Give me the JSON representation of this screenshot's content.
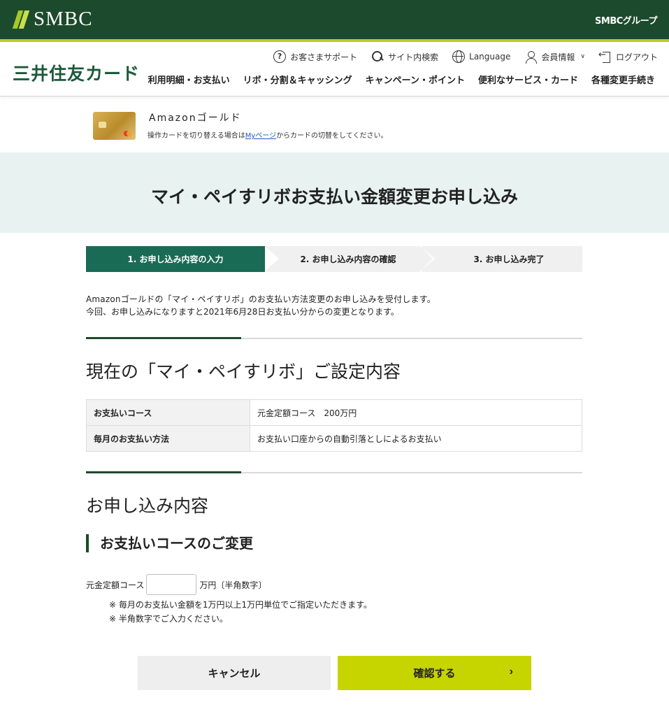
{
  "topbar": {
    "logo_text": "SMBC",
    "group_text": "SMBCグループ"
  },
  "header": {
    "brand": "三井住友カード",
    "util": [
      {
        "label": "お客さまサポート"
      },
      {
        "label": "サイト内検索"
      },
      {
        "label": "Language"
      },
      {
        "label": "会員情報"
      },
      {
        "label": "ログアウト"
      }
    ],
    "gnav": [
      "利用明細・お支払い",
      "リボ・分割＆キャッシング",
      "キャンペーン・ポイント",
      "便利なサービス・カード",
      "各種変更手続き"
    ]
  },
  "card": {
    "name": "Amazonゴールド",
    "note_prefix": "操作カードを切り替える場合は",
    "note_link": "Myページ",
    "note_suffix": "からカードの切替をしてください。"
  },
  "page_title": "マイ・ペイすリボお支払い金額変更お申し込み",
  "steps": [
    {
      "label": "1. お申し込み内容の入力"
    },
    {
      "label": "2. お申し込み内容の確認"
    },
    {
      "label": "3. お申し込み完了"
    }
  ],
  "intro": {
    "line1": "Amazonゴールドの「マイ・ペイすリボ」のお支払い方法変更のお申し込みを受付します。",
    "line2": "今回、お申し込みになりますと2021年6月28日お支払い分からの変更となります。"
  },
  "current": {
    "heading": "現在の「マイ・ペイすリボ」ご設定内容",
    "rows": [
      {
        "label": "お支払いコース",
        "value": "元金定額コース　200万円"
      },
      {
        "label": "毎月のお支払い方法",
        "value": "お支払い口座からの自動引落としによるお支払い"
      }
    ]
  },
  "apply": {
    "heading": "お申し込み内容",
    "subheading": "お支払いコースのご変更",
    "field_label": "元金定額コース",
    "field_value": "",
    "field_unit": "万円〔半角数字〕",
    "notes": [
      "※ 毎月のお支払い金額を1万円以上1万円単位でご指定いただきます。",
      "※ 半角数字でご入力ください。"
    ]
  },
  "buttons": {
    "cancel": "キャンセル",
    "confirm": "確認する",
    "confirm_icon": "chevron-right-icon"
  },
  "colors": {
    "topbar": "#1c4a2c",
    "accent": "#b7cf1e",
    "step_active": "#1a6b55",
    "confirm": "#c6d400",
    "title_band": "#e8f2f0"
  }
}
